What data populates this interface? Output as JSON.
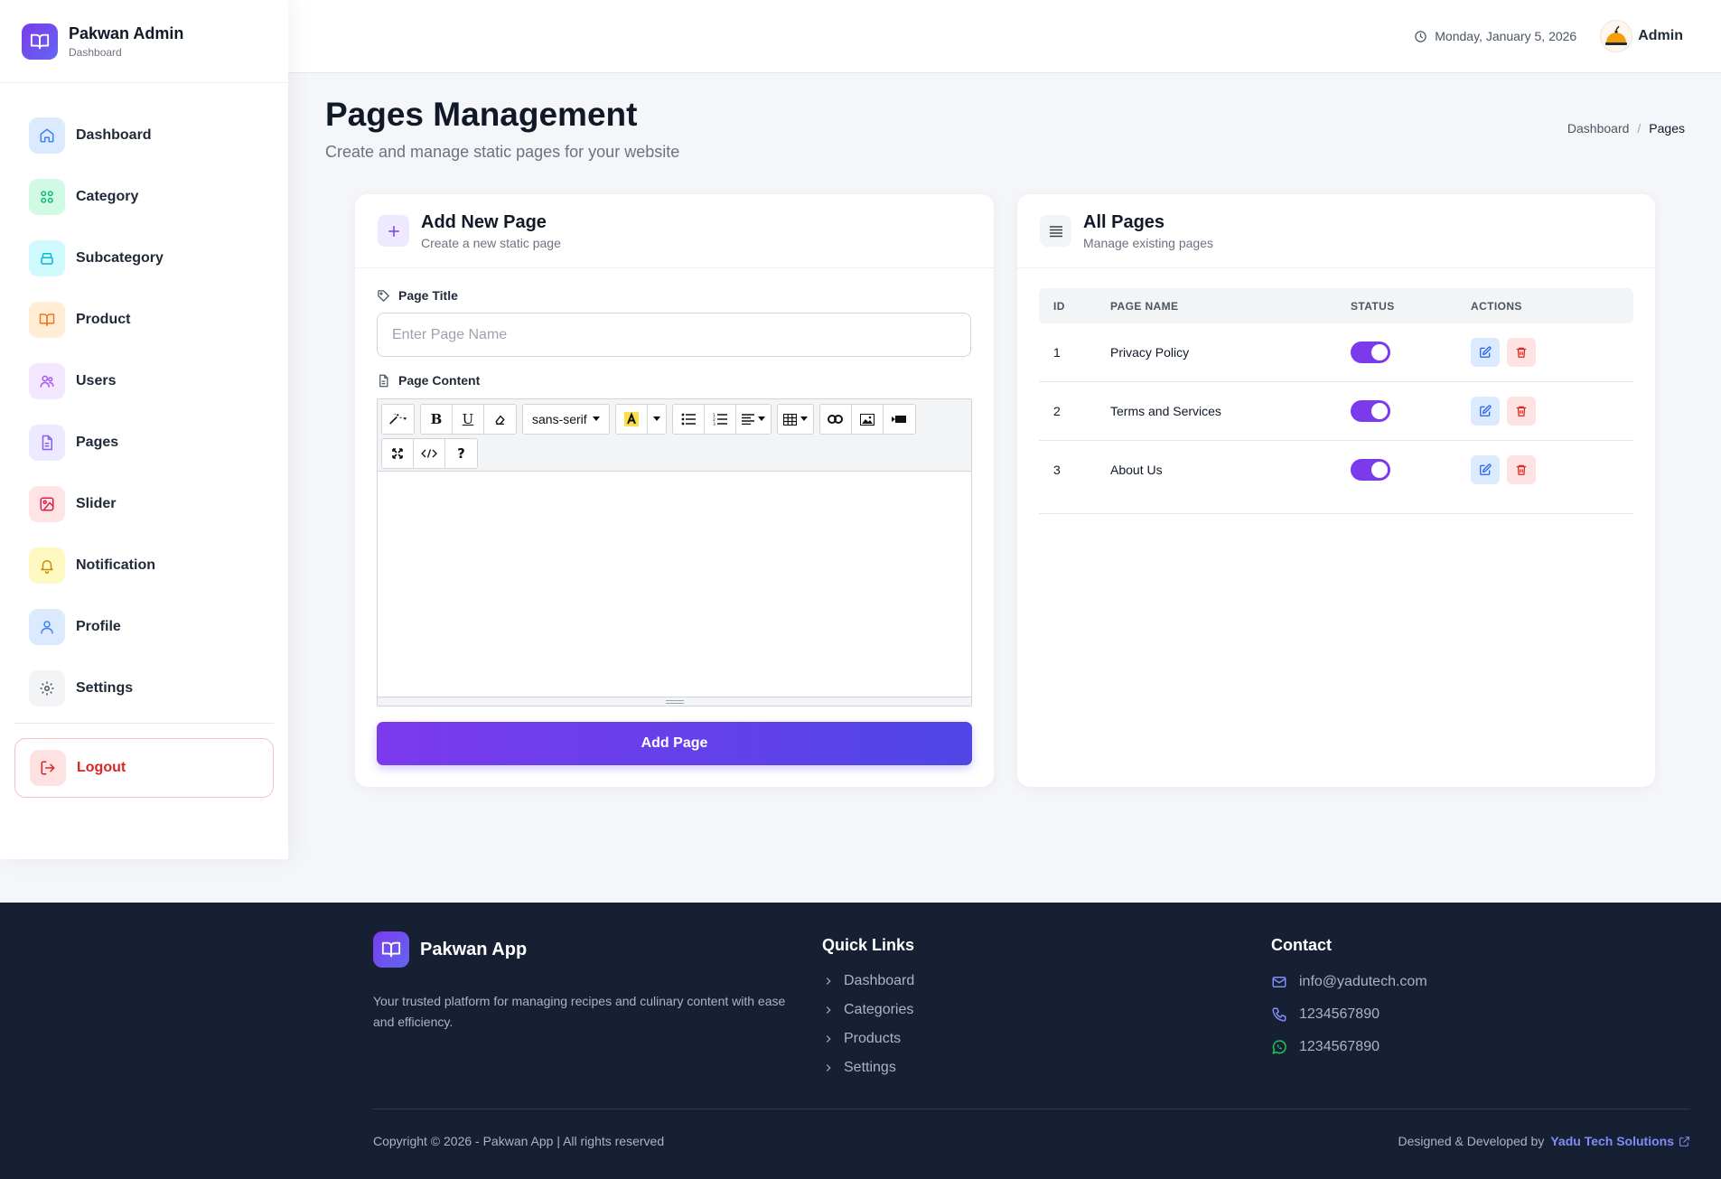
{
  "brand": {
    "title": "Pakwan Admin",
    "subtitle": "Dashboard"
  },
  "sidebar": {
    "items": [
      {
        "label": "Dashboard",
        "icon": "home-icon",
        "color": "#3b82f6",
        "bg": "#dbeafe"
      },
      {
        "label": "Category",
        "icon": "grid-icon",
        "color": "#10b981",
        "bg": "#d1fae5"
      },
      {
        "label": "Subcategory",
        "icon": "layers-icon",
        "color": "#06b6d4",
        "bg": "#cffafe"
      },
      {
        "label": "Product",
        "icon": "book-icon",
        "color": "#f97316",
        "bg": "#ffedd5"
      },
      {
        "label": "Users",
        "icon": "users-icon",
        "color": "#a855f7",
        "bg": "#f3e8ff"
      },
      {
        "label": "Pages",
        "icon": "file-icon",
        "color": "#8b5cf6",
        "bg": "#ede9fe"
      },
      {
        "label": "Slider",
        "icon": "image-icon",
        "color": "#e11d48",
        "bg": "#ffe4e6"
      },
      {
        "label": "Notification",
        "icon": "bell-icon",
        "color": "#ca8a04",
        "bg": "#fef9c3"
      },
      {
        "label": "Profile",
        "icon": "user-icon",
        "color": "#3b82f6",
        "bg": "#dbeafe"
      },
      {
        "label": "Settings",
        "icon": "gear-icon",
        "color": "#4b5563",
        "bg": "#f3f4f6"
      }
    ],
    "logout": "Logout"
  },
  "topbar": {
    "date": "Monday, January 5, 2026",
    "user": "Admin"
  },
  "page": {
    "title": "Pages Management",
    "subtitle": "Create and manage static pages for your website",
    "breadcrumb": [
      "Dashboard",
      "/",
      "Pages"
    ]
  },
  "add_form": {
    "title": "Add New Page",
    "subtitle": "Create a new static page",
    "title_label": "Page Title",
    "title_placeholder": "Enter Page Name",
    "title_value": "",
    "content_label": "Page Content",
    "font_name": "sans-serif",
    "submit": "Add Page"
  },
  "pages_list": {
    "title": "All Pages",
    "subtitle": "Manage existing pages",
    "columns": [
      "ID",
      "PAGE NAME",
      "STATUS",
      "ACTIONS"
    ],
    "rows": [
      {
        "id": "1",
        "name": "Privacy Policy",
        "active": true
      },
      {
        "id": "2",
        "name": "Terms and Services",
        "active": true
      },
      {
        "id": "3",
        "name": "About Us",
        "active": true
      }
    ]
  },
  "footer": {
    "brand": "Pakwan App",
    "description": "Your trusted platform for managing recipes and culinary content with ease and efficiency.",
    "quick_links_heading": "Quick Links",
    "quick_links": [
      "Dashboard",
      "Categories",
      "Products",
      "Settings"
    ],
    "contact_heading": "Contact",
    "email": "info@yadutech.com",
    "phone": "1234567890",
    "whatsapp": "1234567890",
    "copyright": "Copyright © 2026 - Pakwan App | All rights reserved",
    "credit_prefix": "Designed & Developed by",
    "credit_company": "Yadu Tech Solutions"
  },
  "colors": {
    "accent": "#7c3aed",
    "accent2": "#4f46e5",
    "danger": "#dc2626",
    "footer_bg": "#172033"
  }
}
